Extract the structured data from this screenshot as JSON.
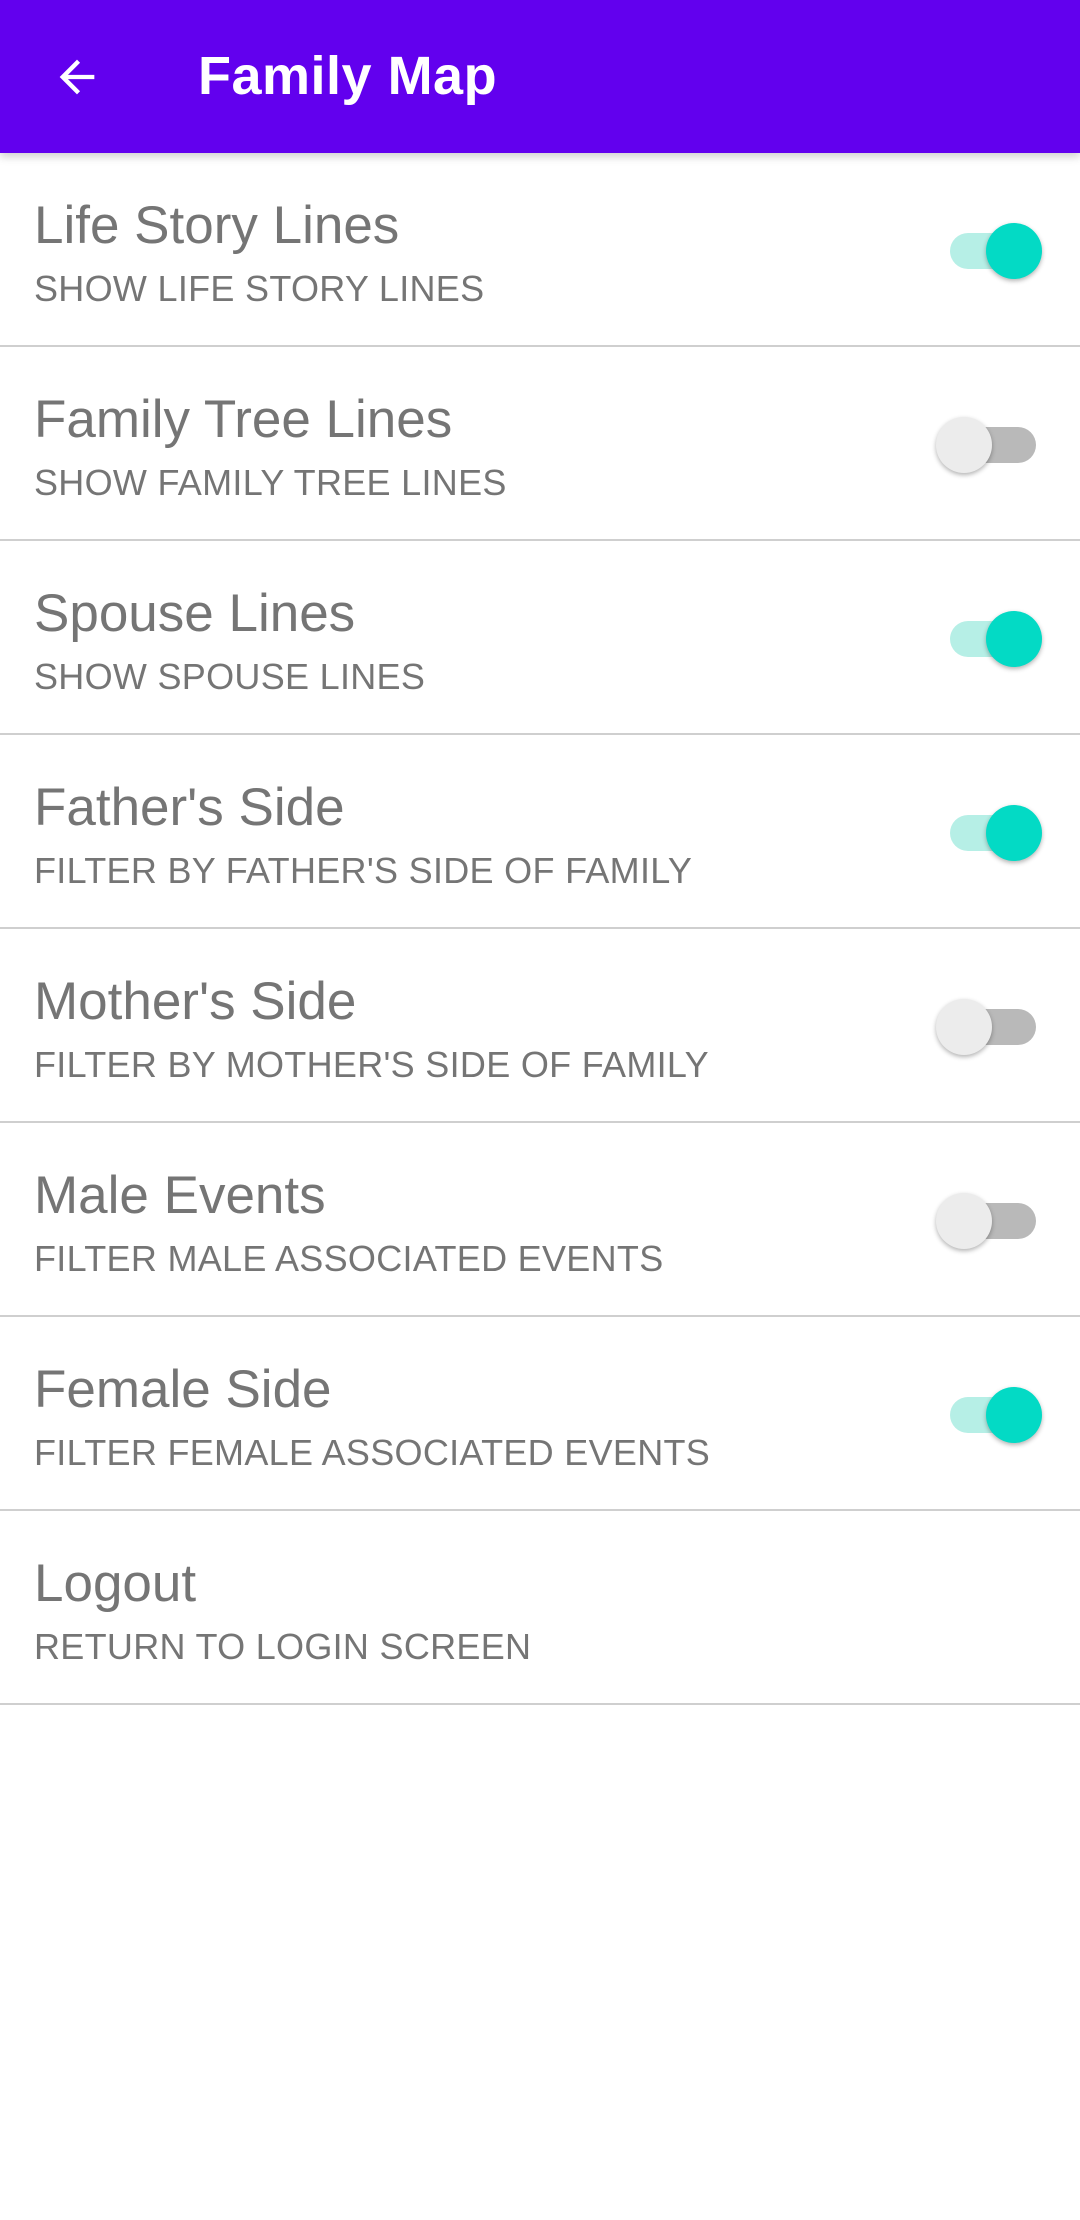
{
  "app_bar": {
    "title": "Family Map",
    "back_icon": "arrow-back-icon",
    "background_color": "#6200ee"
  },
  "accent_color": "#03dac5",
  "settings": [
    {
      "title": "Life Story Lines",
      "subtitle": "SHOW LIFE STORY LINES",
      "enabled": true,
      "has_switch": true
    },
    {
      "title": "Family Tree Lines",
      "subtitle": "SHOW FAMILY TREE LINES",
      "enabled": false,
      "has_switch": true
    },
    {
      "title": "Spouse Lines",
      "subtitle": "SHOW SPOUSE LINES",
      "enabled": true,
      "has_switch": true
    },
    {
      "title": "Father's Side",
      "subtitle": "FILTER BY FATHER'S SIDE OF FAMILY",
      "enabled": true,
      "has_switch": true
    },
    {
      "title": "Mother's Side",
      "subtitle": "FILTER BY MOTHER'S SIDE OF FAMILY",
      "enabled": false,
      "has_switch": true
    },
    {
      "title": "Male Events",
      "subtitle": "FILTER MALE ASSOCIATED EVENTS",
      "enabled": false,
      "has_switch": true
    },
    {
      "title": "Female Side",
      "subtitle": "FILTER FEMALE ASSOCIATED EVENTS",
      "enabled": true,
      "has_switch": true
    },
    {
      "title": "Logout",
      "subtitle": "RETURN TO LOGIN SCREEN",
      "enabled": false,
      "has_switch": false
    }
  ]
}
